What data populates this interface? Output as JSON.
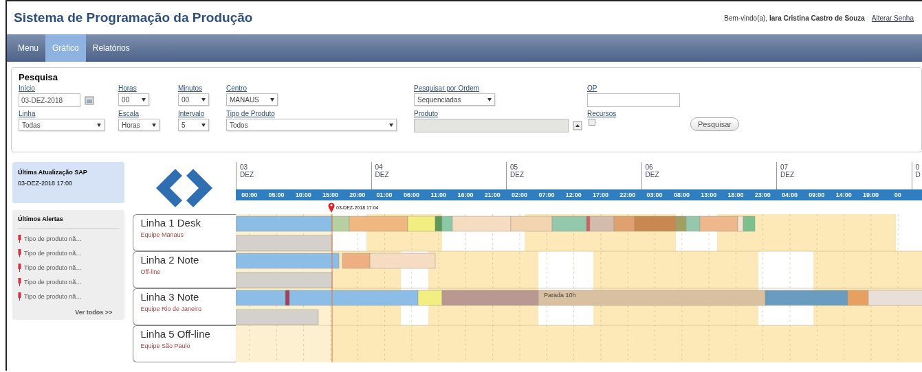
{
  "header": {
    "title": "Sistema de Programação da Produção",
    "welcome": "Bem-vindo(a), **Iara Cristina Castro de Souza**",
    "link": "Alterar Senha"
  },
  "nav": [
    {
      "label": "Menu",
      "selected": false
    },
    {
      "label": "Gráfico",
      "selected": true
    },
    {
      "label": "Relatórios",
      "selected": false
    }
  ],
  "search": {
    "title": "Pesquisa",
    "rows": [
      [
        {
          "label": "Início",
          "kind": "date",
          "value": "03-DEZ-2018"
        },
        {
          "label": "Horas",
          "kind": "select",
          "value": "00"
        },
        {
          "label": "Minutos",
          "kind": "select",
          "value": "00"
        },
        {
          "label": "Centro",
          "kind": "select",
          "value": "MANAUS"
        },
        {
          "label": "Pesquisar por Ordem",
          "kind": "select",
          "value": "Sequenciadas"
        },
        {
          "label": "OP",
          "kind": "text"
        }
      ],
      [
        {
          "label": "Linha",
          "kind": "select",
          "value": "Todas"
        },
        {
          "label": "Escala",
          "kind": "select",
          "value": "Horas"
        },
        {
          "label": "Intervalo",
          "kind": "select",
          "value": "5"
        },
        {
          "label": "Tipo de Produto",
          "kind": "select",
          "value": "Todos"
        },
        {
          "label": "Produto",
          "kind": "picker",
          "disabled": true
        },
        {
          "label": "Recursos",
          "kind": "checkbox",
          "checked": false
        }
      ]
    ],
    "button": "Pesquisar"
  },
  "sap": {
    "title": "Última Atualização SAP",
    "value": "03-DEZ-2018 17:00"
  },
  "alerts": {
    "title": "Últimos Alertas",
    "items": [
      "Tipo de produto nã…",
      "Tipo de produto nã…",
      "Tipo de produto nã…",
      "Tipo de produto nã…",
      "Tipo de produto nã…"
    ],
    "more": "Ver todos >>"
  },
  "timeline": {
    "days": [
      {
        "day": "03",
        "month": "DEZ"
      },
      {
        "day": "04",
        "month": "DEZ"
      },
      {
        "day": "05",
        "month": "DEZ"
      },
      {
        "day": "06",
        "month": "DEZ"
      },
      {
        "day": "07",
        "month": "DEZ"
      },
      {
        "day": "0",
        "month": "D"
      }
    ],
    "hours": [
      "00:00",
      "05:00",
      "10:00",
      "15:00",
      "20:00",
      "01:00",
      "06:00",
      "11:00",
      "16:00",
      "21:00",
      "02:00",
      "07:00",
      "12:00",
      "17:00",
      "22:00",
      "03:00",
      "08:00",
      "13:00",
      "18:00",
      "23:00",
      "04:00",
      "09:00",
      "14:00",
      "19:00",
      "00"
    ],
    "now": "03-DEZ-2018 17:04",
    "lines": [
      {
        "name": "Linha 1 Desk",
        "team": "Equipe Manaus"
      },
      {
        "name": "Linha 2 Note",
        "team": "Off-line"
      },
      {
        "name": "Linha 3 Note",
        "team": "Equipe Rio de Janeiro"
      },
      {
        "name": "Linha 5 Off-line",
        "team": "Equipe São Paulo"
      }
    ],
    "bar_label": "Parada 10h"
  }
}
